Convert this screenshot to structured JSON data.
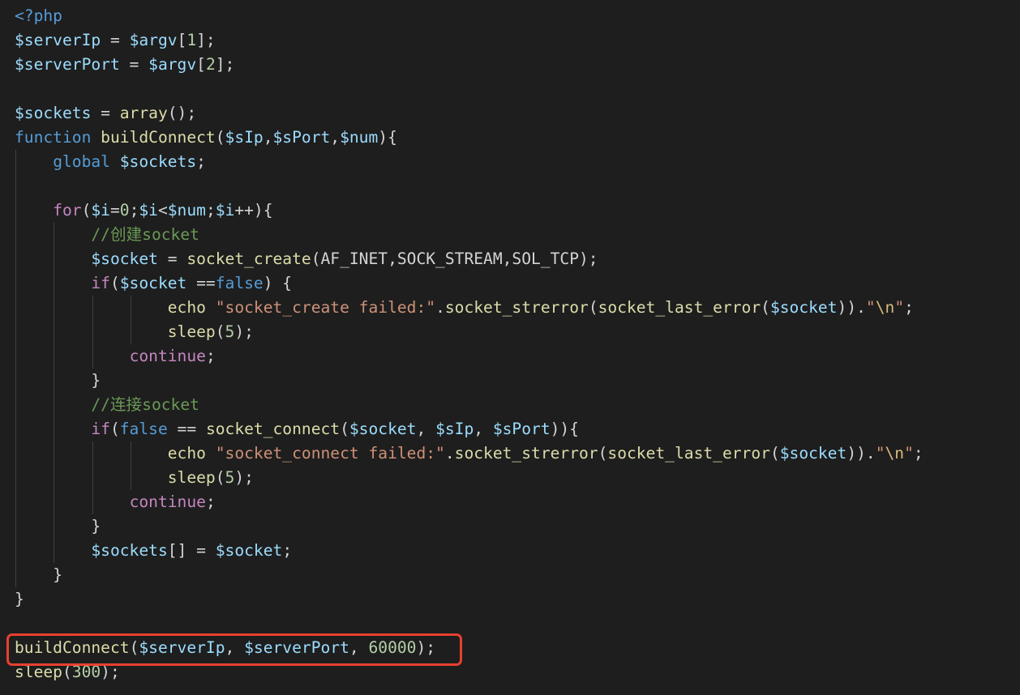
{
  "editor": {
    "language": "php",
    "highlight_color": "#e8412f",
    "highlighted_line_index": 26,
    "lines": [
      {
        "indent": 0,
        "tokens": [
          {
            "t": "<?php",
            "c": "st"
          }
        ]
      },
      {
        "indent": 0,
        "tokens": [
          {
            "t": "$serverIp",
            "c": "var"
          },
          {
            "t": " = ",
            "c": "punc"
          },
          {
            "t": "$argv",
            "c": "var"
          },
          {
            "t": "[",
            "c": "punc"
          },
          {
            "t": "1",
            "c": "num"
          },
          {
            "t": "];",
            "c": "punc"
          }
        ]
      },
      {
        "indent": 0,
        "tokens": [
          {
            "t": "$serverPort",
            "c": "var"
          },
          {
            "t": " = ",
            "c": "punc"
          },
          {
            "t": "$argv",
            "c": "var"
          },
          {
            "t": "[",
            "c": "punc"
          },
          {
            "t": "2",
            "c": "num"
          },
          {
            "t": "];",
            "c": "punc"
          }
        ]
      },
      {
        "indent": 0,
        "tokens": []
      },
      {
        "indent": 0,
        "tokens": [
          {
            "t": "$sockets",
            "c": "var"
          },
          {
            "t": " = ",
            "c": "punc"
          },
          {
            "t": "array",
            "c": "fn"
          },
          {
            "t": "();",
            "c": "punc"
          }
        ]
      },
      {
        "indent": 0,
        "tokens": [
          {
            "t": "function",
            "c": "st"
          },
          {
            "t": " ",
            "c": "punc"
          },
          {
            "t": "buildConnect",
            "c": "fn"
          },
          {
            "t": "(",
            "c": "punc"
          },
          {
            "t": "$sIp",
            "c": "var"
          },
          {
            "t": ",",
            "c": "punc"
          },
          {
            "t": "$sPort",
            "c": "var"
          },
          {
            "t": ",",
            "c": "punc"
          },
          {
            "t": "$num",
            "c": "var"
          },
          {
            "t": "){",
            "c": "punc"
          }
        ]
      },
      {
        "indent": 1,
        "tokens": [
          {
            "t": "    ",
            "c": "punc"
          },
          {
            "t": "global",
            "c": "st"
          },
          {
            "t": " ",
            "c": "punc"
          },
          {
            "t": "$sockets",
            "c": "var"
          },
          {
            "t": ";",
            "c": "punc"
          }
        ]
      },
      {
        "indent": 1,
        "tokens": []
      },
      {
        "indent": 1,
        "tokens": [
          {
            "t": "    ",
            "c": "punc"
          },
          {
            "t": "for",
            "c": "kw"
          },
          {
            "t": "(",
            "c": "punc"
          },
          {
            "t": "$i",
            "c": "var"
          },
          {
            "t": "=",
            "c": "punc"
          },
          {
            "t": "0",
            "c": "num"
          },
          {
            "t": ";",
            "c": "punc"
          },
          {
            "t": "$i",
            "c": "var"
          },
          {
            "t": "<",
            "c": "punc"
          },
          {
            "t": "$num",
            "c": "var"
          },
          {
            "t": ";",
            "c": "punc"
          },
          {
            "t": "$i",
            "c": "var"
          },
          {
            "t": "++){",
            "c": "punc"
          }
        ]
      },
      {
        "indent": 2,
        "tokens": [
          {
            "t": "        ",
            "c": "punc"
          },
          {
            "t": "//创建socket",
            "c": "cmt"
          }
        ]
      },
      {
        "indent": 2,
        "tokens": [
          {
            "t": "        ",
            "c": "punc"
          },
          {
            "t": "$socket",
            "c": "var"
          },
          {
            "t": " = ",
            "c": "punc"
          },
          {
            "t": "socket_create",
            "c": "fn"
          },
          {
            "t": "(AF_INET,SOCK_STREAM,SOL_TCP);",
            "c": "punc"
          }
        ]
      },
      {
        "indent": 2,
        "tokens": [
          {
            "t": "        ",
            "c": "punc"
          },
          {
            "t": "if",
            "c": "kw"
          },
          {
            "t": "(",
            "c": "punc"
          },
          {
            "t": "$socket",
            "c": "var"
          },
          {
            "t": " ==",
            "c": "punc"
          },
          {
            "t": "false",
            "c": "st"
          },
          {
            "t": ") {",
            "c": "punc"
          }
        ]
      },
      {
        "indent": 4,
        "tokens": [
          {
            "t": "                ",
            "c": "punc"
          },
          {
            "t": "echo",
            "c": "fn"
          },
          {
            "t": " ",
            "c": "punc"
          },
          {
            "t": "\"socket_create failed:\"",
            "c": "str"
          },
          {
            "t": ".",
            "c": "punc"
          },
          {
            "t": "socket_strerror",
            "c": "fn"
          },
          {
            "t": "(",
            "c": "punc"
          },
          {
            "t": "socket_last_error",
            "c": "fn"
          },
          {
            "t": "(",
            "c": "punc"
          },
          {
            "t": "$socket",
            "c": "var"
          },
          {
            "t": ")).",
            "c": "punc"
          },
          {
            "t": "\"",
            "c": "str"
          },
          {
            "t": "\\n",
            "c": "esc"
          },
          {
            "t": "\"",
            "c": "str"
          },
          {
            "t": ";",
            "c": "punc"
          }
        ]
      },
      {
        "indent": 4,
        "tokens": [
          {
            "t": "                ",
            "c": "punc"
          },
          {
            "t": "sleep",
            "c": "fn"
          },
          {
            "t": "(",
            "c": "punc"
          },
          {
            "t": "5",
            "c": "num"
          },
          {
            "t": ");",
            "c": "punc"
          }
        ]
      },
      {
        "indent": 3,
        "tokens": [
          {
            "t": "            ",
            "c": "punc"
          },
          {
            "t": "continue",
            "c": "kw"
          },
          {
            "t": ";",
            "c": "punc"
          }
        ]
      },
      {
        "indent": 2,
        "tokens": [
          {
            "t": "        ",
            "c": "punc"
          },
          {
            "t": "}",
            "c": "punc"
          }
        ]
      },
      {
        "indent": 2,
        "tokens": [
          {
            "t": "        ",
            "c": "punc"
          },
          {
            "t": "//连接socket",
            "c": "cmt"
          }
        ]
      },
      {
        "indent": 2,
        "tokens": [
          {
            "t": "        ",
            "c": "punc"
          },
          {
            "t": "if",
            "c": "kw"
          },
          {
            "t": "(",
            "c": "punc"
          },
          {
            "t": "false",
            "c": "st"
          },
          {
            "t": " == ",
            "c": "punc"
          },
          {
            "t": "socket_connect",
            "c": "fn"
          },
          {
            "t": "(",
            "c": "punc"
          },
          {
            "t": "$socket",
            "c": "var"
          },
          {
            "t": ", ",
            "c": "punc"
          },
          {
            "t": "$sIp",
            "c": "var"
          },
          {
            "t": ", ",
            "c": "punc"
          },
          {
            "t": "$sPort",
            "c": "var"
          },
          {
            "t": ")){",
            "c": "punc"
          }
        ]
      },
      {
        "indent": 4,
        "tokens": [
          {
            "t": "                ",
            "c": "punc"
          },
          {
            "t": "echo",
            "c": "fn"
          },
          {
            "t": " ",
            "c": "punc"
          },
          {
            "t": "\"socket_connect failed:\"",
            "c": "str"
          },
          {
            "t": ".",
            "c": "punc"
          },
          {
            "t": "socket_strerror",
            "c": "fn"
          },
          {
            "t": "(",
            "c": "punc"
          },
          {
            "t": "socket_last_error",
            "c": "fn"
          },
          {
            "t": "(",
            "c": "punc"
          },
          {
            "t": "$socket",
            "c": "var"
          },
          {
            "t": ")).",
            "c": "punc"
          },
          {
            "t": "\"",
            "c": "str"
          },
          {
            "t": "\\n",
            "c": "esc"
          },
          {
            "t": "\"",
            "c": "str"
          },
          {
            "t": ";",
            "c": "punc"
          }
        ]
      },
      {
        "indent": 4,
        "tokens": [
          {
            "t": "                ",
            "c": "punc"
          },
          {
            "t": "sleep",
            "c": "fn"
          },
          {
            "t": "(",
            "c": "punc"
          },
          {
            "t": "5",
            "c": "num"
          },
          {
            "t": ");",
            "c": "punc"
          }
        ]
      },
      {
        "indent": 3,
        "tokens": [
          {
            "t": "            ",
            "c": "punc"
          },
          {
            "t": "continue",
            "c": "kw"
          },
          {
            "t": ";",
            "c": "punc"
          }
        ]
      },
      {
        "indent": 2,
        "tokens": [
          {
            "t": "        ",
            "c": "punc"
          },
          {
            "t": "}",
            "c": "punc"
          }
        ]
      },
      {
        "indent": 2,
        "tokens": [
          {
            "t": "        ",
            "c": "punc"
          },
          {
            "t": "$sockets",
            "c": "var"
          },
          {
            "t": "[] = ",
            "c": "punc"
          },
          {
            "t": "$socket",
            "c": "var"
          },
          {
            "t": ";",
            "c": "punc"
          }
        ]
      },
      {
        "indent": 1,
        "tokens": [
          {
            "t": "    ",
            "c": "punc"
          },
          {
            "t": "}",
            "c": "punc"
          }
        ]
      },
      {
        "indent": 0,
        "tokens": [
          {
            "t": "}",
            "c": "punc"
          }
        ]
      },
      {
        "indent": 0,
        "tokens": []
      },
      {
        "indent": 0,
        "tokens": [
          {
            "t": "buildConnect",
            "c": "fn"
          },
          {
            "t": "(",
            "c": "punc"
          },
          {
            "t": "$serverIp",
            "c": "var"
          },
          {
            "t": ", ",
            "c": "punc"
          },
          {
            "t": "$serverPort",
            "c": "var"
          },
          {
            "t": ", ",
            "c": "punc"
          },
          {
            "t": "60000",
            "c": "num"
          },
          {
            "t": ");",
            "c": "punc"
          }
        ]
      },
      {
        "indent": 0,
        "tokens": [
          {
            "t": "sleep",
            "c": "fn"
          },
          {
            "t": "(",
            "c": "punc"
          },
          {
            "t": "300",
            "c": "num"
          },
          {
            "t": ");",
            "c": "punc"
          }
        ]
      }
    ]
  }
}
